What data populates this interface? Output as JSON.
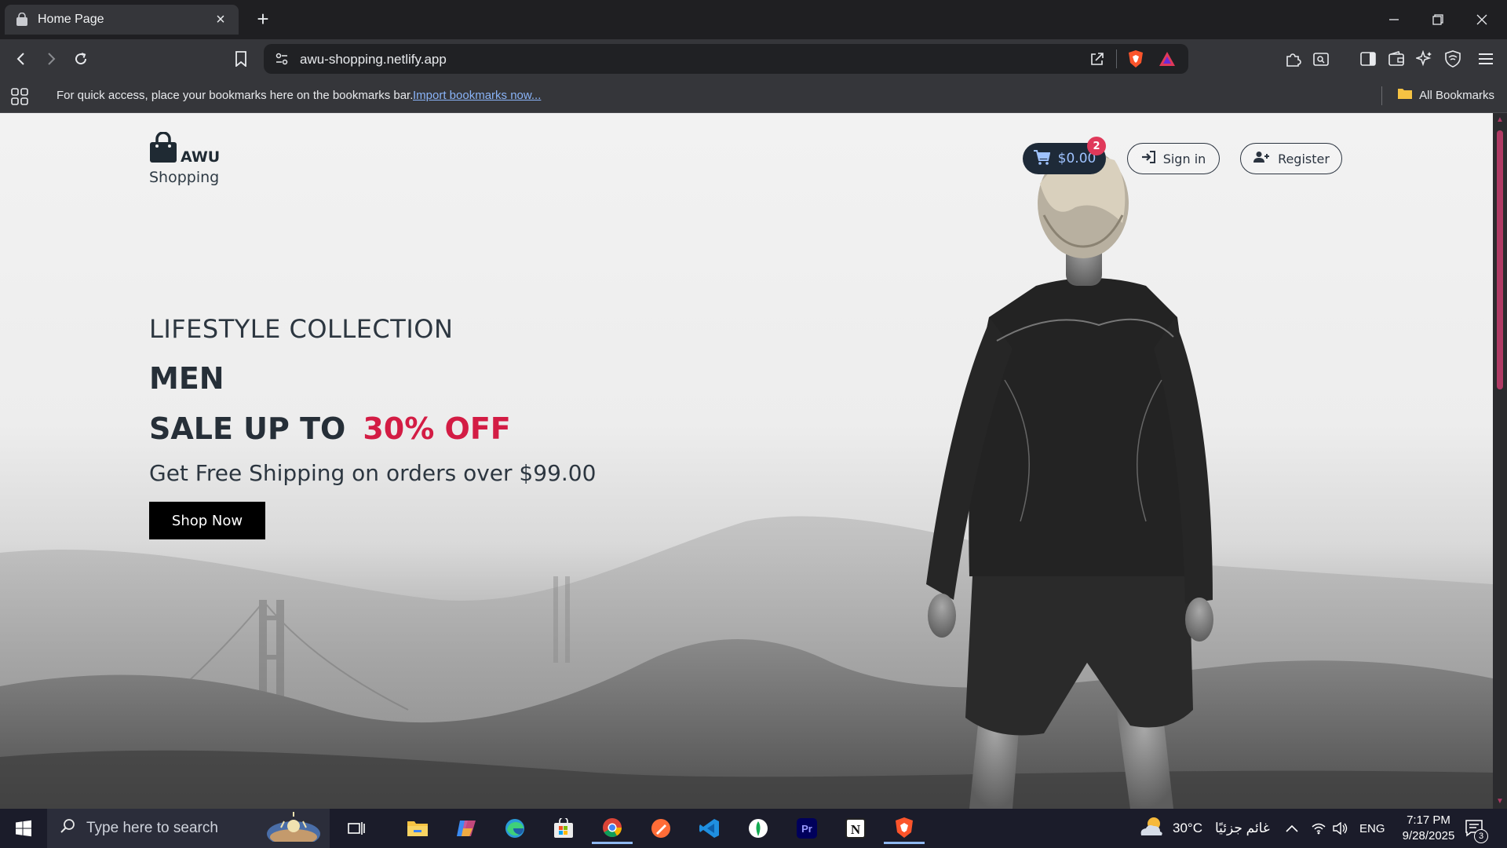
{
  "browser": {
    "tab_title": "Home Page",
    "url": "awu-shopping.netlify.app",
    "bookmarks_hint": "For quick access, place your bookmarks here on the bookmarks bar.",
    "import_link": "Import bookmarks now...",
    "all_bookmarks": "All Bookmarks"
  },
  "site": {
    "logo_brand": "AWU",
    "logo_sub": "Shopping",
    "cart_total": "$0.00",
    "cart_count": "2",
    "sign_in": "Sign in",
    "register": "Register"
  },
  "hero": {
    "kicker": "LIFESTYLE COLLECTION",
    "title": "MEN",
    "sale_prefix": "SALE UP TO",
    "sale_accent": "30% OFF",
    "shipping": "Get Free Shipping on orders over $99.00",
    "cta": "Shop Now"
  },
  "taskbar": {
    "search_placeholder": "Type here to search",
    "weather_temp": "30°C",
    "weather_desc": "غائم جزئيًا",
    "language": "ENG",
    "time": "7:17 PM",
    "date": "9/28/2025",
    "notification_count": "3"
  },
  "colors": {
    "accent_red": "#d31c44",
    "cart_bg": "#1e2a38",
    "badge": "#e0395a"
  }
}
